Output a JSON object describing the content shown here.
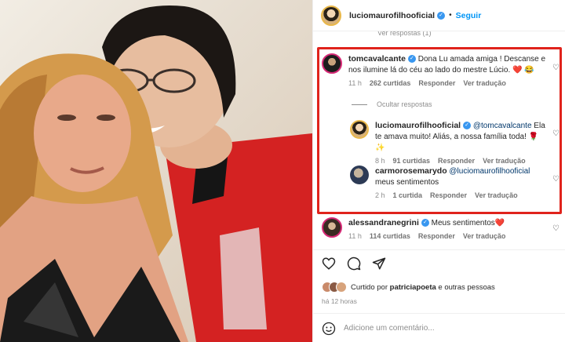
{
  "post": {
    "author": "luciomaurofilhooficial",
    "separator": "•",
    "follow_label": "Seguir",
    "clipped_text": "Ver respostas (1)"
  },
  "comments": [
    {
      "user": "tomcavalcante",
      "text": "Dona Lu amada amiga ! Descanse e nos ilumine lá do céu ao lado do mestre Lúcio. ❤️ 😂",
      "time": "11 h",
      "likes": "262 curtidas",
      "reply": "Responder",
      "translate": "Ver tradução"
    },
    {
      "user": "luciomaurofilhooficial",
      "mention": "@tomcavalcante",
      "text": "Ela te amava muito! Aliás, a nossa família toda! 🌹 ✨",
      "time": "8 h",
      "likes": "91 curtidas",
      "reply": "Responder",
      "translate": "Ver tradução"
    },
    {
      "user": "carmorosemarydo",
      "mention": "@luciomaurofilhooficial",
      "text": "meus sentimentos",
      "time": "2 h",
      "likes": "1 curtida",
      "reply": "Responder",
      "translate": "Ver tradução"
    },
    {
      "user": "alessandranegrini",
      "text": "Meus sentimentos❤️",
      "time": "11 h",
      "likes": "114 curtidas",
      "reply": "Responder",
      "translate": "Ver tradução"
    }
  ],
  "hide_replies": "Ocultar respostas",
  "liked_by": {
    "prefix": "Curtido por",
    "user": "patriciapoeta",
    "suffix": "e outras pessoas"
  },
  "posted_time": "há 12 horas",
  "add_comment_placeholder": "Adicione um comentário...",
  "icons": {
    "verified": "verified-badge-icon",
    "like": "heart-icon",
    "comment": "comment-bubble-icon",
    "share": "paper-plane-icon",
    "emoji": "smiley-icon"
  },
  "colors": {
    "highlight_box": "#e0231c",
    "link_blue": "#0095f6",
    "verified_blue": "#3897f0"
  }
}
